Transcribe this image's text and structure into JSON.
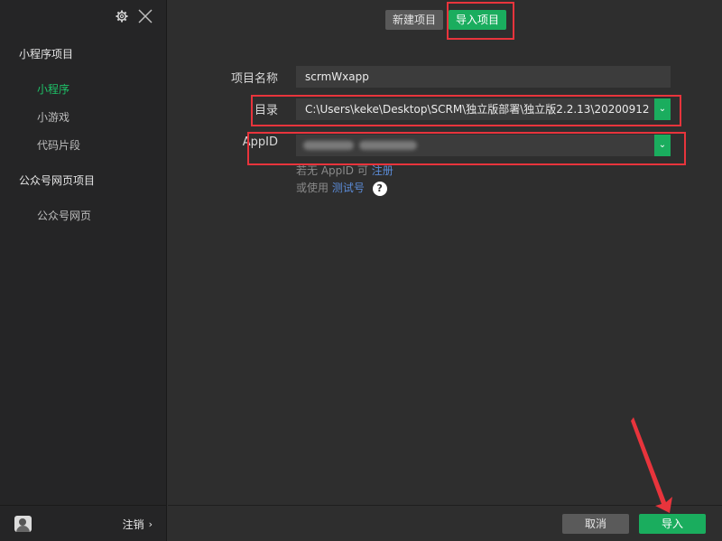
{
  "sidebar": {
    "sections": [
      {
        "title": "小程序项目",
        "items": [
          "小程序",
          "小游戏",
          "代码片段"
        ]
      },
      {
        "title": "公众号网页项目",
        "items": [
          "公众号网页"
        ]
      }
    ],
    "logout_label": "注销",
    "icons": {
      "settings": "gear-icon",
      "close": "close-icon",
      "chevron": "chevron-right-icon"
    }
  },
  "tabs": {
    "new_label": "新建项目",
    "import_label": "导入项目",
    "active": "import"
  },
  "form": {
    "name_label": "项目名称",
    "name_value": "scrmWxapp",
    "dir_label": "目录",
    "dir_value": "C:\\Users\\keke\\Desktop\\SCRM\\独立版部署\\独立版2.2.13\\20200912",
    "appid_label": "AppID",
    "appid_value": "",
    "hint1_prefix": "若无 AppID 可",
    "hint1_link": "注册",
    "hint2_prefix": "或使用",
    "hint2_link": "测试号",
    "help_icon": "?"
  },
  "footer": {
    "cancel_label": "取消",
    "import_label": "导入"
  },
  "colors": {
    "accent": "#1aad5e",
    "annotation": "#e8343c",
    "link": "#5b8bd6"
  }
}
